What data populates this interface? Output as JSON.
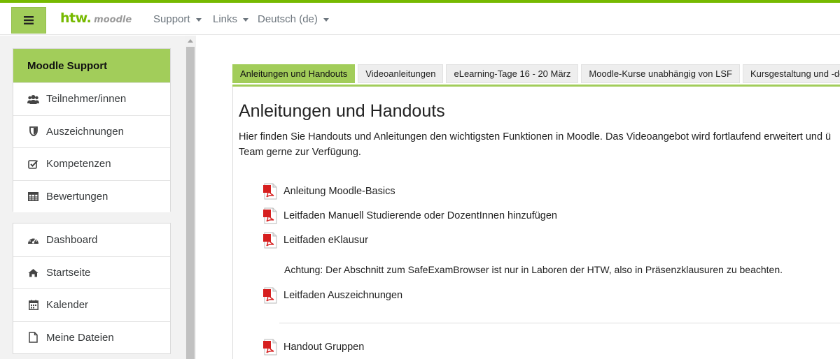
{
  "navbar": {
    "logo_main": "htw.",
    "logo_sub": "moodle",
    "menus": [
      {
        "label": "Support"
      },
      {
        "label": "Links"
      },
      {
        "label": "Deutsch (de)"
      }
    ]
  },
  "sidebar": {
    "course_title": "Moodle Support",
    "course_items": [
      {
        "label": "Teilnehmer/innen",
        "icon": "users-icon"
      },
      {
        "label": "Auszeichnungen",
        "icon": "shield-icon"
      },
      {
        "label": "Kompetenzen",
        "icon": "checkbox-icon"
      },
      {
        "label": "Bewertungen",
        "icon": "table-icon"
      }
    ],
    "site_items": [
      {
        "label": "Dashboard",
        "icon": "dashboard-icon"
      },
      {
        "label": "Startseite",
        "icon": "home-icon"
      },
      {
        "label": "Kalender",
        "icon": "calendar-icon"
      },
      {
        "label": "Meine Dateien",
        "icon": "file-icon"
      }
    ]
  },
  "tabs": [
    {
      "label": "Anleitungen und Handouts",
      "active": true
    },
    {
      "label": "Videoanleitungen",
      "active": false
    },
    {
      "label": "eLearning-Tage 16 - 20 März",
      "active": false
    },
    {
      "label": "Moodle-Kurse unabhängig von LSF",
      "active": false
    },
    {
      "label": "Kursgestaltung und -design",
      "active": false
    }
  ],
  "main": {
    "title": "Anleitungen und Handouts",
    "description_line1": "Hier finden Sie Handouts und Anleitungen den wichtigsten Funktionen in Moodle. Das Videoangebot wird fortlaufend erweitert und ü",
    "description_line2": "Team gerne zur Verfügung.",
    "resources": [
      {
        "label": "Anleitung Moodle-Basics",
        "icon": "pdf-icon"
      },
      {
        "label": "Leitfaden Manuell Studierende oder DozentInnen hinzufügen",
        "icon": "pdf-icon"
      },
      {
        "label": "Leitfaden eKlausur",
        "icon": "pdf-icon"
      },
      {
        "label": "Leitfaden Auszeichnungen",
        "icon": "pdf-icon"
      },
      {
        "label": "Handout Gruppen",
        "icon": "pdf-icon"
      }
    ],
    "note": "Achtung: Der Abschnitt zum SafeExamBrowser ist nur in Laboren der HTW, also in Präsenzklausuren zu beachten."
  },
  "colors": {
    "accent_green": "#a2cd5a",
    "brand_green": "#76b900",
    "pdf_red": "#d61f1f"
  }
}
